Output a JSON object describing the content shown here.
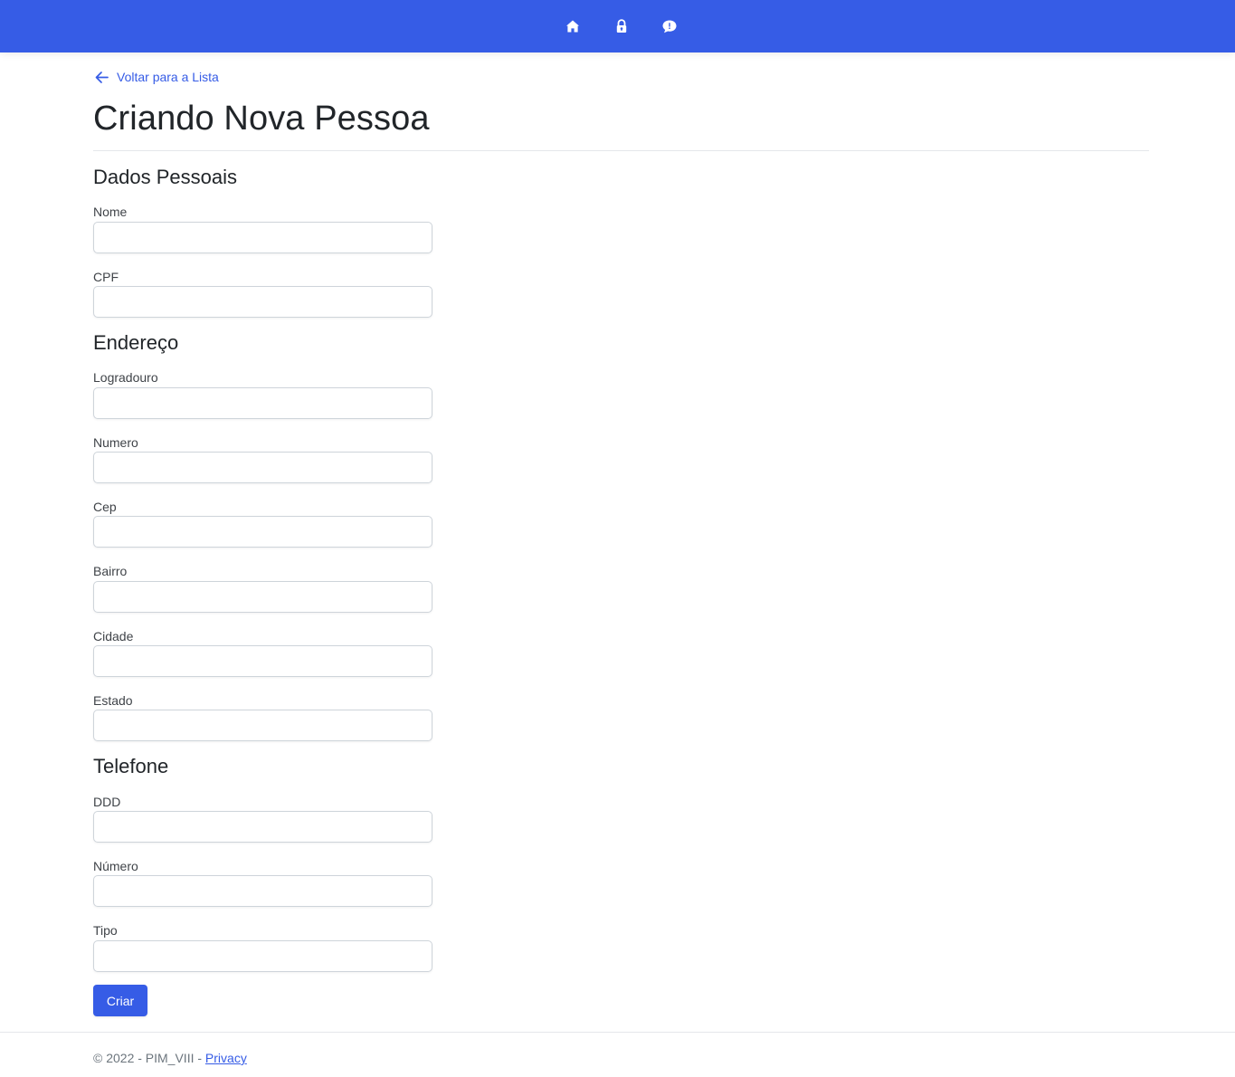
{
  "header": {
    "background": "#365ce6",
    "icons": [
      "home-icon",
      "lock-icon",
      "chat-alert-icon"
    ]
  },
  "back_link": {
    "label": "Voltar para a Lista"
  },
  "page": {
    "title": "Criando Nova Pessoa"
  },
  "sections": {
    "personal": {
      "title": "Dados Pessoais",
      "fields": {
        "nome": "Nome",
        "cpf": "CPF"
      }
    },
    "address": {
      "title": "Endereço",
      "fields": {
        "logradouro": "Logradouro",
        "numero": "Numero",
        "cep": "Cep",
        "bairro": "Bairro",
        "cidade": "Cidade",
        "estado": "Estado"
      }
    },
    "phone": {
      "title": "Telefone",
      "fields": {
        "ddd": "DDD",
        "numero": "Número",
        "tipo": "Tipo"
      }
    }
  },
  "form": {
    "submit_label": "Criar"
  },
  "footer": {
    "copyright": "© 2022 - PIM_VIII - ",
    "privacy_label": "Privacy"
  },
  "colors": {
    "accent": "#365ce6",
    "border": "#ced4da",
    "divider": "#e5e7eb"
  }
}
